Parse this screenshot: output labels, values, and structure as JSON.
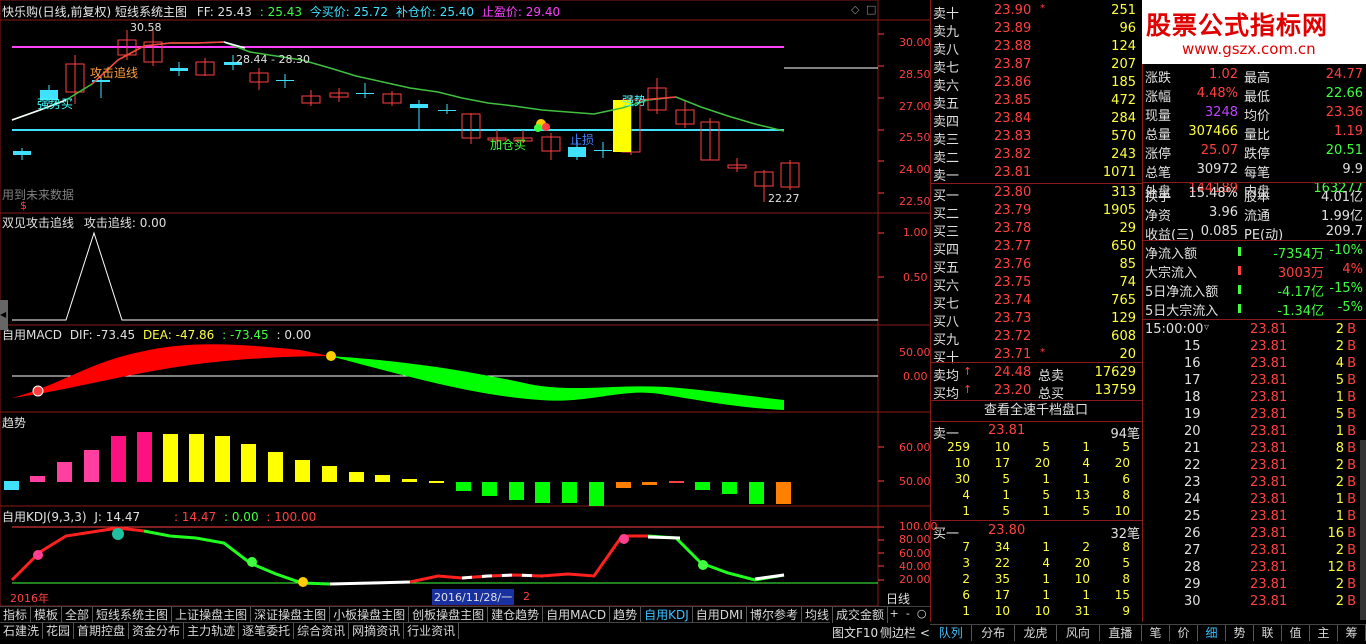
{
  "header": {
    "title": "快乐购(日线,前复权) 短线系统主图",
    "ff": "FF: 25.43",
    "v1": ": 25.43",
    "buy": "今买价: 25.72",
    "add": "补仓价: 25.40",
    "stop": "止盈价: 29.40"
  },
  "main": {
    "price_ticks": [
      "30.00",
      "28.50",
      "27.00",
      "25.50",
      "24.00",
      "22.50"
    ],
    "labels": {
      "high": "30.58",
      "low": "22.27",
      "range": "28.44 - 28.30",
      "attack": "攻击追线",
      "strong1": "强势买",
      "add_buy": "加仓买",
      "stop_loss": "止损",
      "strong2": "强势",
      "future": "用到未来数据",
      "dollar": "$"
    }
  },
  "panel2": {
    "title": "双见攻击追线",
    "value": "攻击追线: 0.00",
    "ticks": [
      "1.00",
      "0.50"
    ]
  },
  "panel3": {
    "title": "自用MACD",
    "dif": "DIF: -73.45",
    "dea": "DEA: -47.86",
    "v": ": -73.45",
    "z": ": 0.00",
    "ticks": [
      "50.00",
      "0.00"
    ]
  },
  "panel4": {
    "title": "趋势",
    "ticks": [
      "60.00",
      "50.00"
    ]
  },
  "panel5": {
    "title": "自用KDJ(9,3,3)",
    "j": "J: 14.47",
    "a": ": 14.47",
    "b": ": 0.00",
    "c": ": 100.00",
    "ticks": [
      "100.00",
      "80.00",
      "60.00",
      "40.00",
      "20.00"
    ],
    "year": "2016年",
    "date": "2016/11/28/一",
    "date_suffix": "2"
  },
  "bottom_tabs": [
    "指标",
    "模板",
    "全部",
    "短线系统主图",
    "上证操盘主图",
    "深证操盘主图",
    "小板操盘主图",
    "创板操盘主图",
    "建仓趋势",
    "自用MACD",
    "趋势",
    "自用KDJ",
    "自用DMI",
    "博尔参考",
    "均线",
    "成交金额"
  ],
  "bottom_tabs2": [
    "石建洗",
    "花园",
    "首期控盘",
    "资金分布",
    "主力轨迹",
    "逐笔委托",
    "综合资讯",
    "网摘资讯",
    "行业资讯"
  ],
  "period": "日线",
  "period_btns": [
    "+",
    "-",
    "○"
  ],
  "f10": "图文F10",
  "sidebar_btn": "侧边栏 <",
  "order_book": {
    "sells": [
      {
        "label": "卖十",
        "price": "23.90",
        "vol": "251",
        "mark": "*"
      },
      {
        "label": "卖九",
        "price": "23.89",
        "vol": "96",
        "mark": ""
      },
      {
        "label": "卖八",
        "price": "23.88",
        "vol": "124",
        "mark": ""
      },
      {
        "label": "卖七",
        "price": "23.87",
        "vol": "207",
        "mark": ""
      },
      {
        "label": "卖六",
        "price": "23.86",
        "vol": "185",
        "mark": ""
      },
      {
        "label": "卖五",
        "price": "23.85",
        "vol": "472",
        "mark": ""
      },
      {
        "label": "卖四",
        "price": "23.84",
        "vol": "284",
        "mark": ""
      },
      {
        "label": "卖三",
        "price": "23.83",
        "vol": "570",
        "mark": ""
      },
      {
        "label": "卖二",
        "price": "23.82",
        "vol": "243",
        "mark": ""
      },
      {
        "label": "卖一",
        "price": "23.81",
        "vol": "1071",
        "mark": ""
      }
    ],
    "buys": [
      {
        "label": "买一",
        "price": "23.80",
        "vol": "313",
        "mark": ""
      },
      {
        "label": "买二",
        "price": "23.79",
        "vol": "1905",
        "mark": ""
      },
      {
        "label": "买三",
        "price": "23.78",
        "vol": "29",
        "mark": ""
      },
      {
        "label": "买四",
        "price": "23.77",
        "vol": "650",
        "mark": ""
      },
      {
        "label": "买五",
        "price": "23.76",
        "vol": "85",
        "mark": ""
      },
      {
        "label": "买六",
        "price": "23.75",
        "vol": "74",
        "mark": ""
      },
      {
        "label": "买七",
        "price": "23.74",
        "vol": "765",
        "mark": ""
      },
      {
        "label": "买八",
        "price": "23.73",
        "vol": "129",
        "mark": ""
      },
      {
        "label": "买九",
        "price": "23.72",
        "vol": "608",
        "mark": ""
      },
      {
        "label": "买十",
        "price": "23.71",
        "vol": "20",
        "mark": "*"
      }
    ],
    "avg_sell": {
      "label": "卖均",
      "price": "24.48",
      "total_label": "总卖",
      "total": "17629"
    },
    "avg_buy": {
      "label": "买均",
      "price": "23.20",
      "total_label": "总买",
      "total": "13759"
    },
    "view_all": "查看全速千档盘口",
    "sell1_queue": {
      "label": "卖一",
      "price": "23.81",
      "count": "94笔",
      "rows": [
        [
          "259",
          "10",
          "5",
          "1",
          "5"
        ],
        [
          "10",
          "17",
          "20",
          "4",
          "20"
        ],
        [
          "30",
          "5",
          "1",
          "1",
          "6"
        ],
        [
          "4",
          "1",
          "5",
          "13",
          "8"
        ],
        [
          "1",
          "5",
          "1",
          "5",
          "10"
        ]
      ]
    },
    "buy1_queue": {
      "label": "买一",
      "price": "23.80",
      "count": "32笔",
      "rows": [
        [
          "7",
          "34",
          "1",
          "2",
          "8"
        ],
        [
          "3",
          "22",
          "4",
          "20",
          "5"
        ],
        [
          "2",
          "35",
          "1",
          "10",
          "8"
        ],
        [
          "6",
          "17",
          "1",
          "1",
          "15"
        ],
        [
          "1",
          "10",
          "10",
          "31",
          "9"
        ]
      ]
    }
  },
  "stats": [
    {
      "l1": "涨跌",
      "v1": "1.02",
      "l2": "最高",
      "v2": "24.77",
      "c1": "#ff4040",
      "c2": "#ff4040"
    },
    {
      "l1": "涨幅",
      "v1": "4.48%",
      "l2": "最低",
      "v2": "22.66",
      "c1": "#ff4040",
      "c2": "#40ff40"
    },
    {
      "l1": "现量",
      "v1": "3248",
      "l2": "均价",
      "v2": "23.36",
      "c1": "#c040ff",
      "c2": "#ff4040"
    },
    {
      "l1": "总量",
      "v1": "307466",
      "l2": "量比",
      "v2": "1.19",
      "c1": "#ffff40",
      "c2": "#ff4040"
    },
    {
      "l1": "涨停",
      "v1": "25.07",
      "l2": "跌停",
      "v2": "20.51",
      "c1": "#ff4040",
      "c2": "#40ff40"
    },
    {
      "l1": "总笔",
      "v1": "30972",
      "l2": "每笔",
      "v2": "9.9",
      "c1": "#e0e0e0",
      "c2": "#e0e0e0"
    },
    {
      "l1": "外盘",
      "v1": "144189",
      "l2": "内盘",
      "v2": "163277",
      "c1": "#ff4040",
      "c2": "#40ff40"
    },
    {
      "l1": "换手",
      "v1": "15.48%",
      "l2": "股本",
      "v2": "4.01亿",
      "c1": "#e0e0e0",
      "c2": "#e0e0e0"
    },
    {
      "l1": "净资",
      "v1": "3.96",
      "l2": "流通",
      "v2": "1.99亿",
      "c1": "#e0e0e0",
      "c2": "#e0e0e0"
    },
    {
      "l1": "收益(三)",
      "v1": "0.085",
      "l2": "PE(动)",
      "v2": "209.7",
      "c1": "#e0e0e0",
      "c2": "#e0e0e0"
    }
  ],
  "flows": [
    {
      "label": "净流入额",
      "value": "-7354万",
      "pct": "-10%",
      "color": "#40ff40"
    },
    {
      "label": "大宗流入",
      "value": "3003万",
      "pct": "4%",
      "color": "#ff4040"
    },
    {
      "label": "5日净流入额",
      "value": "-4.17亿",
      "pct": "-15%",
      "color": "#40ff40"
    },
    {
      "label": "5日大宗流入",
      "value": "-1.34亿",
      "pct": "-5%",
      "color": "#40ff40"
    }
  ],
  "ticks": {
    "time": "15:00:00",
    "rows": [
      {
        "min": "",
        "price": "23.81",
        "vol": "2",
        "bs": "B"
      },
      {
        "min": "15",
        "price": "23.81",
        "vol": "2",
        "bs": "B"
      },
      {
        "min": "16",
        "price": "23.81",
        "vol": "4",
        "bs": "B"
      },
      {
        "min": "17",
        "price": "23.81",
        "vol": "5",
        "bs": "B"
      },
      {
        "min": "18",
        "price": "23.81",
        "vol": "1",
        "bs": "B"
      },
      {
        "min": "19",
        "price": "23.81",
        "vol": "5",
        "bs": "B"
      },
      {
        "min": "20",
        "price": "23.81",
        "vol": "1",
        "bs": "B"
      },
      {
        "min": "21",
        "price": "23.81",
        "vol": "8",
        "bs": "B"
      },
      {
        "min": "22",
        "price": "23.81",
        "vol": "2",
        "bs": "B"
      },
      {
        "min": "23",
        "price": "23.81",
        "vol": "2",
        "bs": "B"
      },
      {
        "min": "24",
        "price": "23.81",
        "vol": "1",
        "bs": "B"
      },
      {
        "min": "25",
        "price": "23.81",
        "vol": "1",
        "bs": "B"
      },
      {
        "min": "26",
        "price": "23.81",
        "vol": "16",
        "bs": "B"
      },
      {
        "min": "27",
        "price": "23.81",
        "vol": "2",
        "bs": "B"
      },
      {
        "min": "28",
        "price": "23.81",
        "vol": "12",
        "bs": "B"
      },
      {
        "min": "29",
        "price": "23.81",
        "vol": "2",
        "bs": "B"
      },
      {
        "min": "30",
        "price": "23.81",
        "vol": "2",
        "bs": "B"
      }
    ]
  },
  "book_tabs": [
    "队列",
    "分布",
    "龙虎",
    "风向",
    "直播"
  ],
  "right_tabs": [
    "笔",
    "价",
    "细",
    "势",
    "联",
    "值",
    "主",
    "筹"
  ],
  "watermark": {
    "title": "股票公式指标网",
    "url": "www.gszx.com.cn"
  },
  "colors": {
    "up": "#ff4040",
    "down": "#40ff40",
    "cyan": "#40e0ff",
    "yellow": "#ffff40",
    "frame": "#8b1a1a"
  }
}
